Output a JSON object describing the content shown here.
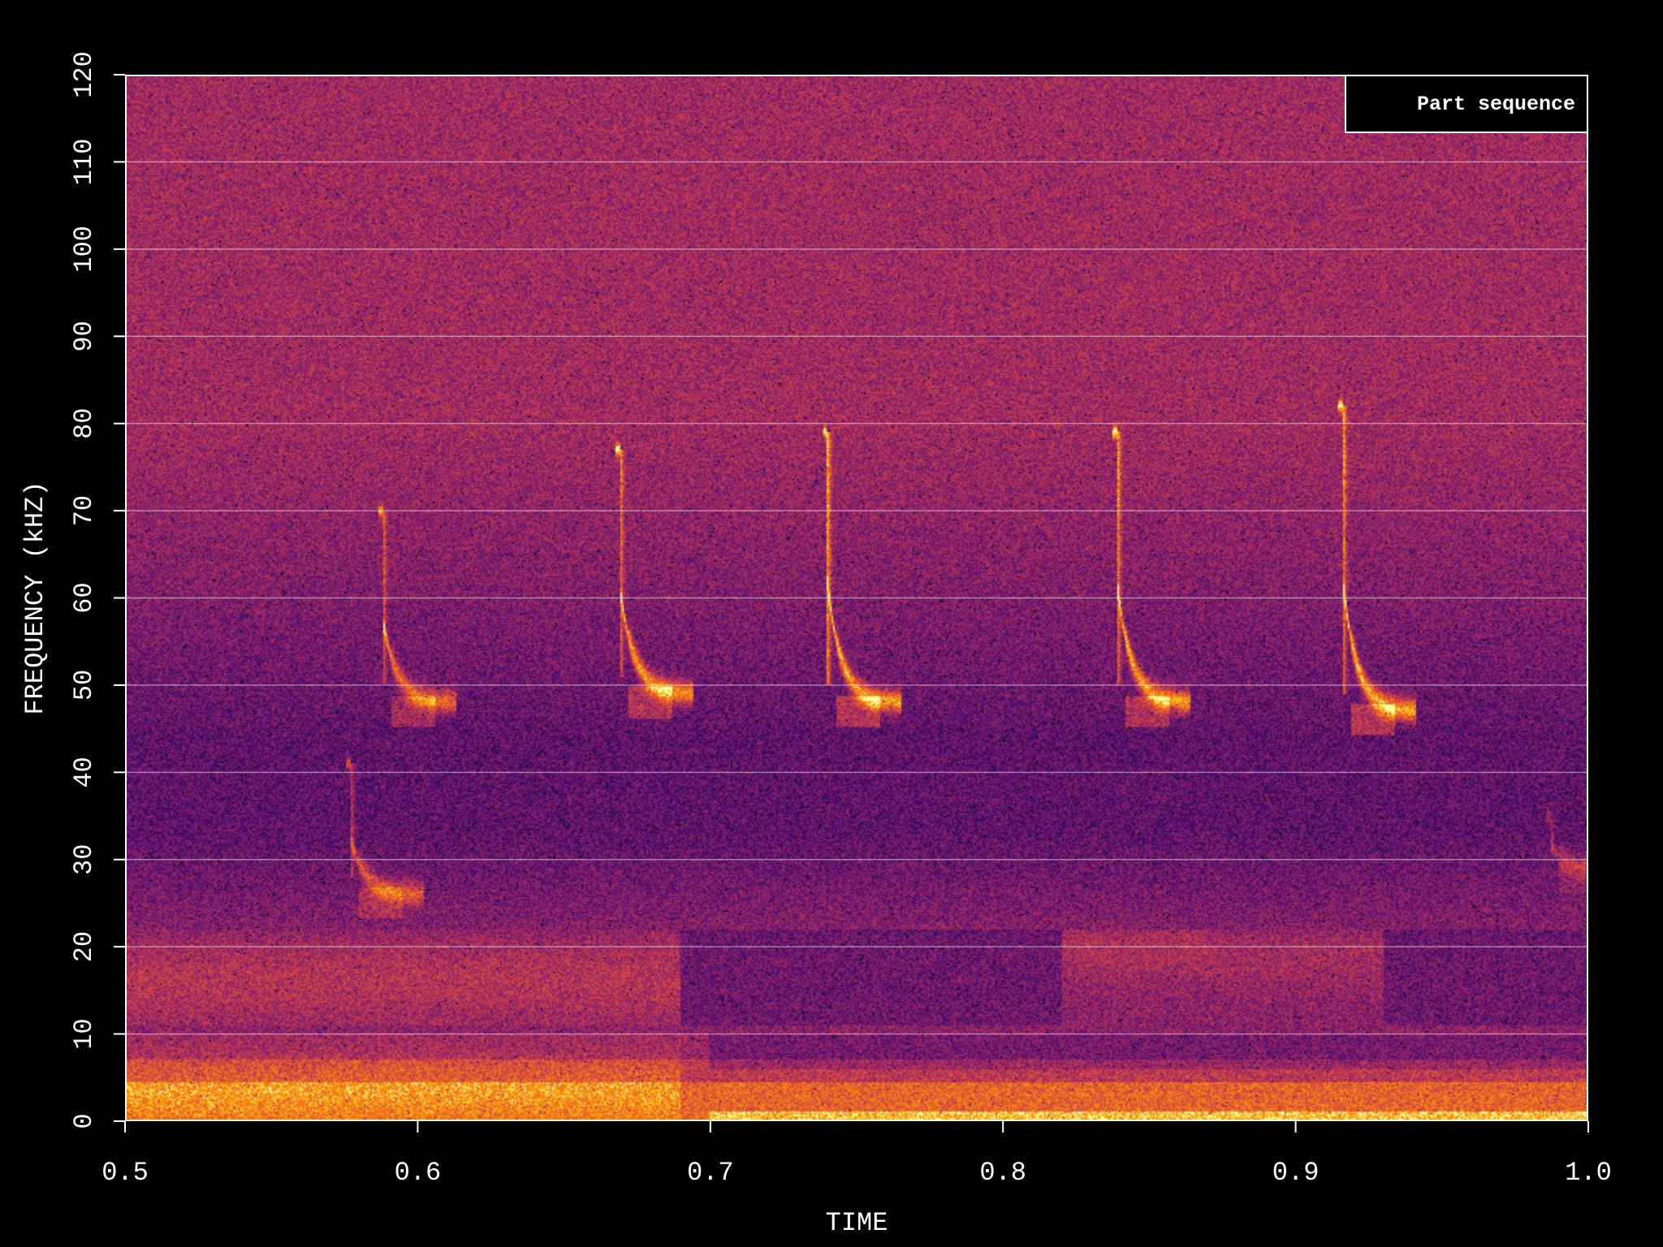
{
  "chart_data": {
    "type": "heatmap",
    "subtype": "spectrogram",
    "xlabel": "TIME",
    "ylabel": "FREQUENCY (kHZ)",
    "xlim": [
      0.5,
      1.0
    ],
    "ylim": [
      0,
      120
    ],
    "x_ticks": [
      "0.5",
      "0.6",
      "0.7",
      "0.8",
      "0.9",
      "1.0"
    ],
    "y_ticks": [
      "0",
      "10",
      "20",
      "30",
      "40",
      "50",
      "60",
      "70",
      "80",
      "90",
      "100",
      "110",
      "120"
    ],
    "y_gridlines": true,
    "colormap": "inferno",
    "legend": {
      "label": "Part sequence",
      "placement": "top-right"
    },
    "calls": [
      {
        "t": 0.588,
        "f_start": 70,
        "f_end": 48,
        "intensity": 0.75
      },
      {
        "t": 0.669,
        "f_start": 77,
        "f_end": 49,
        "intensity": 0.9
      },
      {
        "t": 0.74,
        "f_start": 79,
        "f_end": 48,
        "intensity": 0.95
      },
      {
        "t": 0.839,
        "f_start": 79,
        "f_end": 48,
        "intensity": 0.95
      },
      {
        "t": 0.916,
        "f_start": 82,
        "f_end": 47,
        "intensity": 1.0
      },
      {
        "t": 0.577,
        "f_start": 41,
        "f_end": 26,
        "intensity": 0.6
      },
      {
        "t": 0.987,
        "f_start": 35,
        "f_end": 29,
        "intensity": 0.35
      }
    ]
  }
}
